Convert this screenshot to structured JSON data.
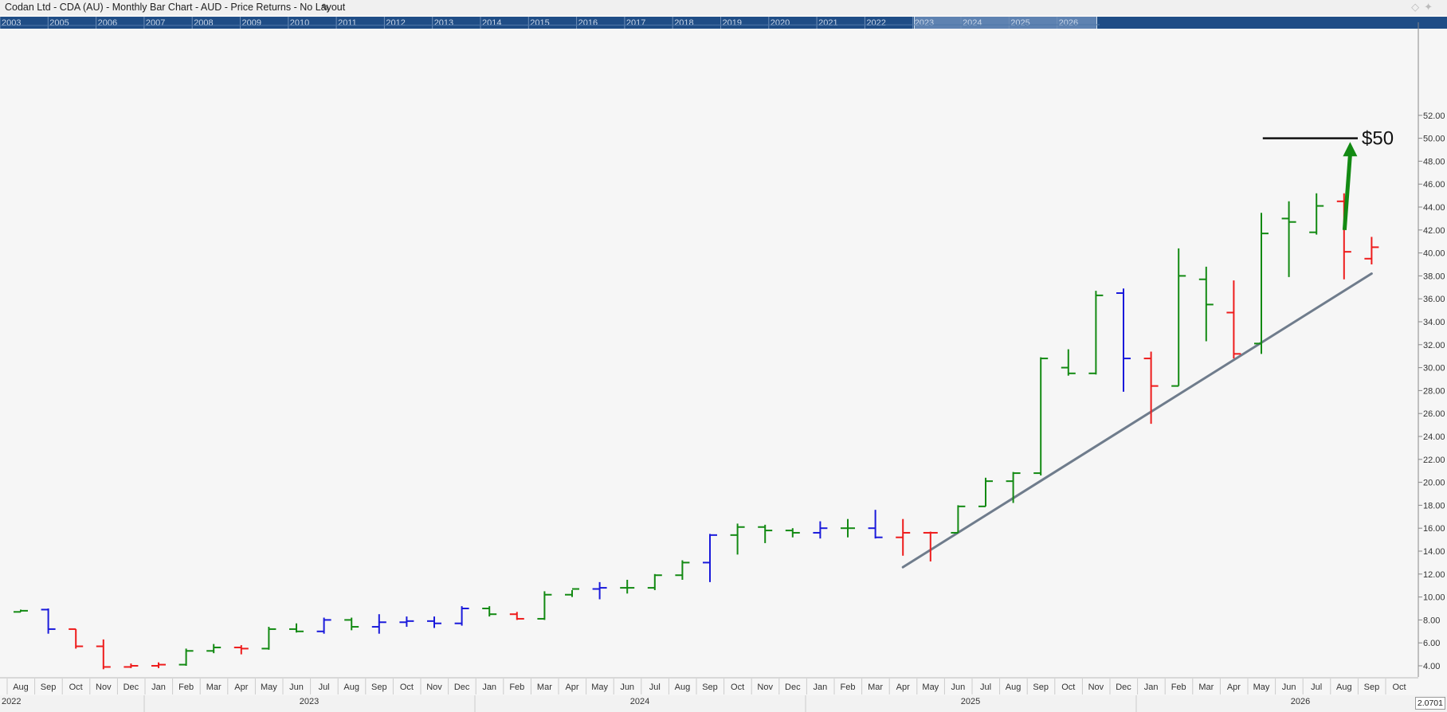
{
  "header": {
    "title": "Codan Ltd - CDA (AU) - Monthly Bar Chart - AUD - Price Returns - No Layout"
  },
  "navigator": {
    "years": [
      "2003",
      "2005",
      "2006",
      "2007",
      "2008",
      "2009",
      "2010",
      "2011",
      "2012",
      "2013",
      "2014",
      "2015",
      "2016",
      "2017",
      "2018",
      "2019",
      "2020",
      "2021",
      "2022",
      "2023",
      "2024",
      "2025",
      "2026"
    ],
    "selected_range": [
      "2022",
      "2026"
    ]
  },
  "price_readout": "2.0701",
  "annotation": {
    "target_label": "$50",
    "target_value": 50
  },
  "colors": {
    "up": "#138a13",
    "down": "#ee1c1c",
    "neutral": "#1a1adb",
    "trendline": "#6f7c8c",
    "arrow": "#138a13",
    "navigator": "#1f4d86"
  },
  "chart_data": {
    "type": "bar",
    "subtype": "ohlc",
    "ylim": [
      2.5,
      52
    ],
    "y_ticks": [
      "4.00",
      "6.00",
      "8.00",
      "10.00",
      "12.00",
      "14.00",
      "16.00",
      "18.00",
      "20.00",
      "22.00",
      "24.00",
      "26.00",
      "28.00",
      "30.00",
      "32.00",
      "34.00",
      "36.00",
      "38.00",
      "40.00",
      "42.00",
      "44.00",
      "46.00",
      "48.00",
      "50.00",
      "52.00"
    ],
    "month_labels": [
      "Aug",
      "Sep",
      "Oct",
      "Nov",
      "Dec",
      "Jan",
      "Feb",
      "Mar",
      "Apr",
      "May",
      "Jun",
      "Jul",
      "Aug",
      "Sep",
      "Oct",
      "Nov",
      "Dec",
      "Jan",
      "Feb",
      "Mar",
      "Apr",
      "May",
      "Jun",
      "Jul",
      "Aug",
      "Sep",
      "Oct",
      "Nov",
      "Dec",
      "Jan",
      "Feb",
      "Mar",
      "Apr",
      "May",
      "Jun",
      "Jul",
      "Aug",
      "Sep",
      "Oct",
      "Nov",
      "Dec",
      "Jan",
      "Feb",
      "Mar",
      "Apr",
      "May",
      "Jun",
      "Jul",
      "Aug",
      "Sep",
      "Oct"
    ],
    "year_labels": [
      "2022",
      "2023",
      "2024",
      "2025",
      "2026"
    ],
    "bars": [
      {
        "o": 8.7,
        "h": 8.9,
        "l": 8.7,
        "c": 8.8,
        "t": "up"
      },
      {
        "o": 8.9,
        "h": 9.0,
        "l": 6.8,
        "c": 7.2,
        "t": "neutral"
      },
      {
        "o": 7.2,
        "h": 7.2,
        "l": 5.5,
        "c": 5.7,
        "t": "down"
      },
      {
        "o": 5.7,
        "h": 6.3,
        "l": 3.7,
        "c": 3.9,
        "t": "down"
      },
      {
        "o": 3.9,
        "h": 4.2,
        "l": 3.8,
        "c": 4.0,
        "t": "down"
      },
      {
        "o": 4.0,
        "h": 4.3,
        "l": 3.8,
        "c": 4.1,
        "t": "down"
      },
      {
        "o": 4.1,
        "h": 5.5,
        "l": 4.0,
        "c": 5.3,
        "t": "up"
      },
      {
        "o": 5.3,
        "h": 5.9,
        "l": 5.1,
        "c": 5.6,
        "t": "up"
      },
      {
        "o": 5.6,
        "h": 5.8,
        "l": 5.0,
        "c": 5.5,
        "t": "down"
      },
      {
        "o": 5.5,
        "h": 7.4,
        "l": 5.4,
        "c": 7.2,
        "t": "up"
      },
      {
        "o": 7.2,
        "h": 7.7,
        "l": 6.9,
        "c": 7.0,
        "t": "up"
      },
      {
        "o": 7.0,
        "h": 8.2,
        "l": 6.8,
        "c": 8.0,
        "t": "neutral"
      },
      {
        "o": 8.0,
        "h": 8.2,
        "l": 7.1,
        "c": 7.4,
        "t": "up"
      },
      {
        "o": 7.4,
        "h": 8.5,
        "l": 6.8,
        "c": 7.8,
        "t": "neutral"
      },
      {
        "o": 7.8,
        "h": 8.3,
        "l": 7.4,
        "c": 7.9,
        "t": "neutral"
      },
      {
        "o": 7.9,
        "h": 8.3,
        "l": 7.3,
        "c": 7.7,
        "t": "neutral"
      },
      {
        "o": 7.7,
        "h": 9.2,
        "l": 7.5,
        "c": 9.0,
        "t": "neutral"
      },
      {
        "o": 9.0,
        "h": 9.2,
        "l": 8.3,
        "c": 8.5,
        "t": "up"
      },
      {
        "o": 8.5,
        "h": 8.7,
        "l": 8.0,
        "c": 8.1,
        "t": "down"
      },
      {
        "o": 8.1,
        "h": 10.5,
        "l": 8.0,
        "c": 10.2,
        "t": "up"
      },
      {
        "o": 10.2,
        "h": 10.6,
        "l": 10.0,
        "c": 10.7,
        "t": "up"
      },
      {
        "o": 10.7,
        "h": 11.3,
        "l": 9.8,
        "c": 10.8,
        "t": "neutral"
      },
      {
        "o": 10.8,
        "h": 11.5,
        "l": 10.3,
        "c": 10.8,
        "t": "up"
      },
      {
        "o": 10.8,
        "h": 12.0,
        "l": 10.6,
        "c": 11.9,
        "t": "up"
      },
      {
        "o": 11.9,
        "h": 13.2,
        "l": 11.5,
        "c": 13.0,
        "t": "up"
      },
      {
        "o": 13.0,
        "h": 15.5,
        "l": 11.3,
        "c": 15.4,
        "t": "neutral"
      },
      {
        "o": 15.4,
        "h": 16.4,
        "l": 13.7,
        "c": 16.1,
        "t": "up"
      },
      {
        "o": 16.1,
        "h": 16.3,
        "l": 14.7,
        "c": 15.8,
        "t": "up"
      },
      {
        "o": 15.8,
        "h": 16.0,
        "l": 15.2,
        "c": 15.6,
        "t": "up"
      },
      {
        "o": 15.6,
        "h": 16.6,
        "l": 15.1,
        "c": 16.0,
        "t": "neutral"
      },
      {
        "o": 16.0,
        "h": 16.8,
        "l": 15.2,
        "c": 16.0,
        "t": "up"
      },
      {
        "o": 16.0,
        "h": 17.6,
        "l": 15.1,
        "c": 15.2,
        "t": "neutral"
      },
      {
        "o": 15.2,
        "h": 16.8,
        "l": 13.6,
        "c": 15.6,
        "t": "down"
      },
      {
        "o": 15.6,
        "h": 15.7,
        "l": 13.1,
        "c": 15.6,
        "t": "down"
      },
      {
        "o": 15.6,
        "h": 18.0,
        "l": 15.6,
        "c": 17.9,
        "t": "up"
      },
      {
        "o": 17.9,
        "h": 20.4,
        "l": 17.9,
        "c": 20.1,
        "t": "up"
      },
      {
        "o": 20.1,
        "h": 20.9,
        "l": 18.2,
        "c": 20.8,
        "t": "up"
      },
      {
        "o": 20.8,
        "h": 30.9,
        "l": 20.6,
        "c": 30.8,
        "t": "up"
      },
      {
        "o": 30.0,
        "h": 31.6,
        "l": 29.3,
        "c": 29.5,
        "t": "up"
      },
      {
        "o": 29.5,
        "h": 36.7,
        "l": 29.4,
        "c": 36.3,
        "t": "up"
      },
      {
        "o": 36.5,
        "h": 36.9,
        "l": 27.9,
        "c": 30.8,
        "t": "neutral"
      },
      {
        "o": 30.8,
        "h": 31.4,
        "l": 25.1,
        "c": 28.4,
        "t": "down"
      },
      {
        "o": 28.4,
        "h": 40.4,
        "l": 28.4,
        "c": 38.0,
        "t": "up"
      },
      {
        "o": 37.7,
        "h": 38.8,
        "l": 32.3,
        "c": 35.5,
        "t": "up"
      },
      {
        "o": 34.8,
        "h": 37.6,
        "l": 30.8,
        "c": 31.2,
        "t": "down"
      },
      {
        "o": 32.1,
        "h": 43.5,
        "l": 31.2,
        "c": 41.7,
        "t": "up"
      },
      {
        "o": 43.0,
        "h": 44.5,
        "l": 37.9,
        "c": 42.7,
        "t": "up"
      },
      {
        "o": 41.8,
        "h": 45.2,
        "l": 41.6,
        "c": 44.1,
        "t": "up"
      },
      {
        "o": 44.5,
        "h": 45.2,
        "l": 37.7,
        "c": 40.1,
        "t": "down"
      },
      {
        "o": 39.5,
        "h": 41.4,
        "l": 39.0,
        "c": 40.5,
        "t": "down"
      }
    ],
    "trendline": {
      "from": {
        "month": "Apr 2025",
        "value": 12.6
      },
      "to": {
        "month": "Sep 2026",
        "value": 38.2
      }
    },
    "target_line": {
      "from": "Aug 2026",
      "to": "Oct 2026",
      "value": 50
    },
    "target_arrow": {
      "month": "Sep 2026",
      "from": 42.0,
      "to": 49.4
    }
  }
}
